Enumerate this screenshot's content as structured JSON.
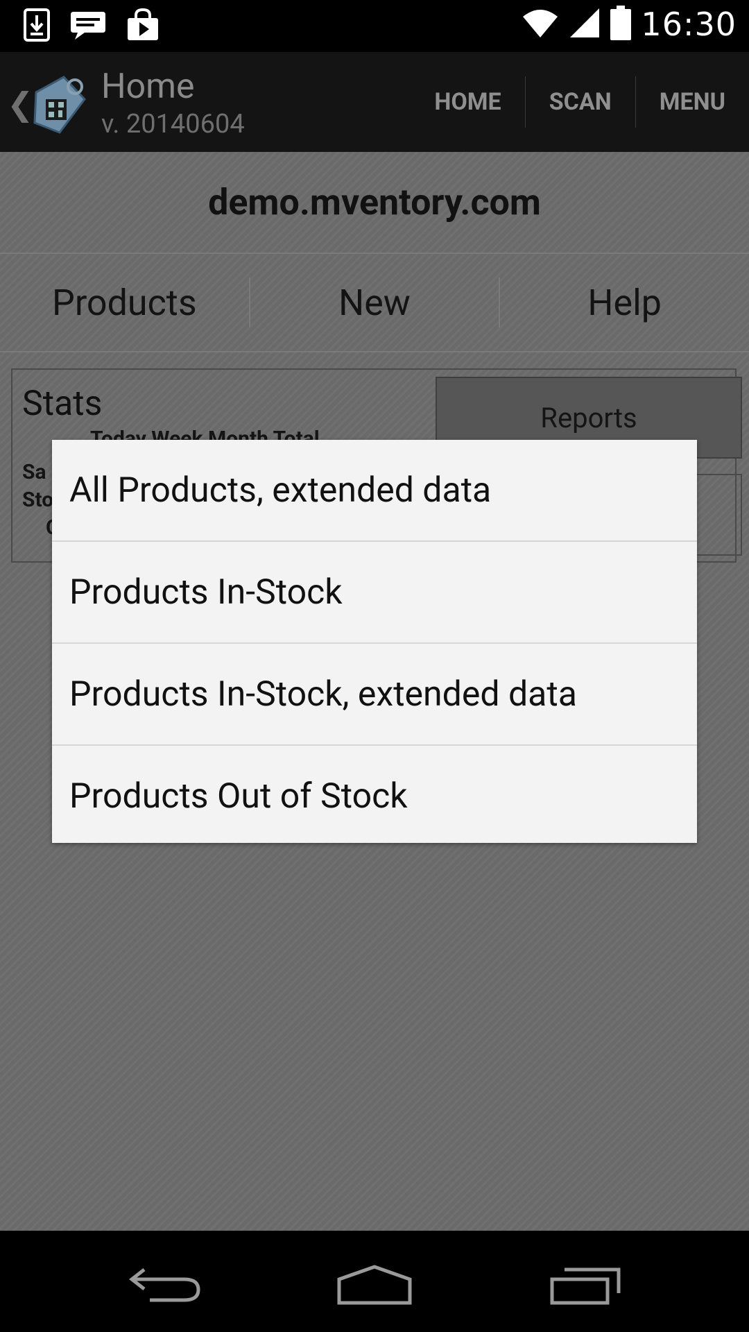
{
  "status_bar": {
    "time": "16:30",
    "left_icons": [
      "download-icon",
      "chat-bubble-icon",
      "play-store-icon"
    ],
    "right_icons": [
      "wifi-icon",
      "signal-icon",
      "battery-icon"
    ]
  },
  "action_bar": {
    "title": "Home",
    "version": "v. 20140604",
    "actions": [
      "HOME",
      "SCAN",
      "MENU"
    ]
  },
  "content": {
    "domain": "demo.mventory.com",
    "nav_tabs": [
      "Products",
      "New",
      "Help"
    ],
    "stats": {
      "title": "Stats",
      "columns_partial": "Today  Week  Month      Total",
      "row_labels_partial": [
        "Sa",
        "Sto",
        "C"
      ],
      "reports_button": "Reports"
    }
  },
  "dialog": {
    "items": [
      "All Products, extended data",
      "Products In-Stock",
      "Products In-Stock, extended data",
      "Products Out of Stock"
    ]
  },
  "nav_bar": {
    "buttons": [
      "back-icon",
      "home-icon",
      "recent-apps-icon"
    ]
  }
}
